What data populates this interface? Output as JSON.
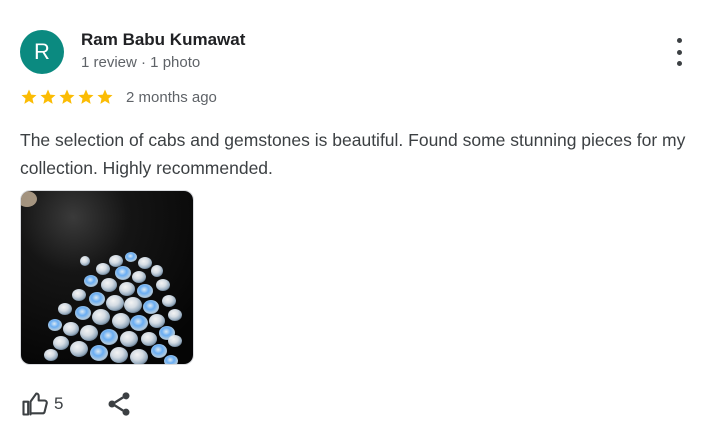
{
  "reviewer": {
    "initial": "R",
    "name": "Ram Babu Kumawat",
    "stats": "1 review · 1 photo",
    "avatar_color": "#0b8a80"
  },
  "review": {
    "rating": 5,
    "max_rating": 5,
    "star_color": "#fbbc04",
    "time": "2 months ago",
    "text": "The selection of cabs and gemstones is beautiful. Found some stunning pieces for my collection. Highly recommended."
  },
  "photo": {
    "alt": "Moonstone cabochons on dark background"
  },
  "actions": {
    "like_icon": "thumbs-up-icon",
    "like_count": "5",
    "share_icon": "share-icon",
    "more_icon": "more-vertical-icon"
  }
}
